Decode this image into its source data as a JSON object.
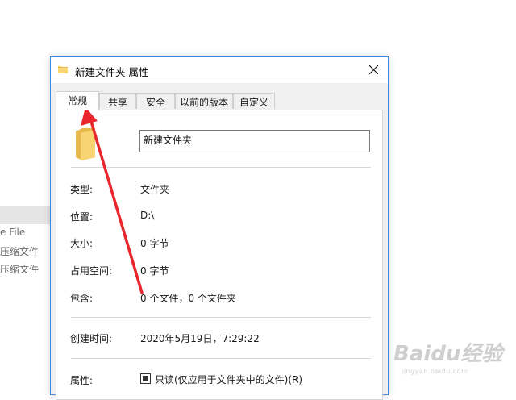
{
  "background_menu": {
    "items": [
      "e File",
      "压缩文件",
      "压缩文件"
    ]
  },
  "dialog": {
    "title": "新建文件夹 属性",
    "tabs": [
      "常规",
      "共享",
      "安全",
      "以前的版本",
      "自定义"
    ],
    "active_tab": "常规",
    "folder_name": "新建文件夹",
    "properties": [
      {
        "label": "类型:",
        "value": "文件夹"
      },
      {
        "label": "位置:",
        "value": "D:\\"
      },
      {
        "label": "大小:",
        "value": "0 字节"
      },
      {
        "label": "占用空间:",
        "value": "0 字节"
      },
      {
        "label": "包含:",
        "value": "0 个文件，0 个文件夹"
      }
    ],
    "created_label": "创建时间:",
    "created_value": "2020年5月19日，7:29:22",
    "attributes_label": "属性:",
    "readonly_label": "只读(仅应用于文件夹中的文件)(R)",
    "readonly_checked": true
  },
  "annotation": {
    "arrow_color": "#e8262b",
    "points_to": "tab-general"
  },
  "watermark": {
    "text": "Baidu经验",
    "sub": "jingyan.baidu.com"
  },
  "colors": {
    "dialog_border": "#3c8ae0",
    "folder": "#f8d572",
    "folder_dark": "#e7b84a"
  }
}
